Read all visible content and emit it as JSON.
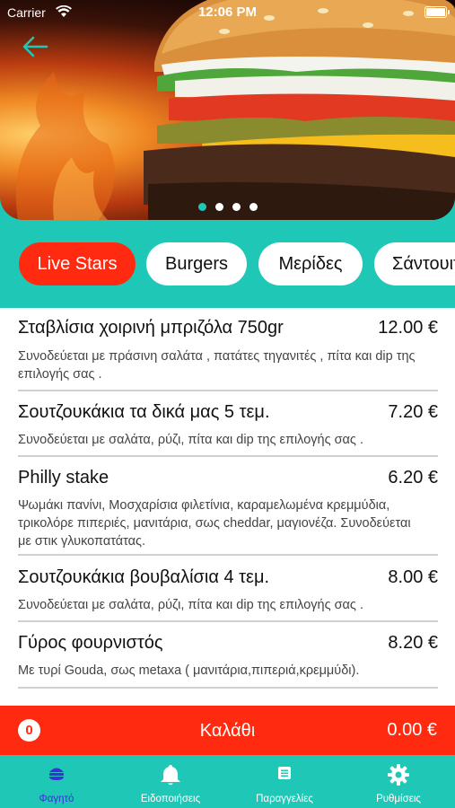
{
  "status_bar": {
    "carrier": "Carrier",
    "time": "12:06 PM"
  },
  "carousel": {
    "page_count": 4,
    "active_index": 0
  },
  "categories": [
    {
      "label": "Live Stars",
      "active": true
    },
    {
      "label": "Burgers",
      "active": false
    },
    {
      "label": "Μερίδες",
      "active": false
    },
    {
      "label": "Σάντουιτς",
      "active": false
    }
  ],
  "menu": {
    "items": [
      {
        "name": "Σταβλίσια χοιρινή μπριζόλα 750gr",
        "price": "12.00 €",
        "description": "Συνοδεύεται με πράσινη σαλάτα , πατάτες τηγανιτές , πίτα και dip της επιλογής σας ."
      },
      {
        "name": "Σουτζουκάκια τα δικά μας 5 τεμ.",
        "price": "7.20 €",
        "description": "Συνοδεύεται με σαλάτα, ρύζι, πίτα και dip της επιλογής σας ."
      },
      {
        "name": "Philly stake",
        "price": "6.20 €",
        "description": "Ψωμάκι πανίνι, Μοσχαρίσια φιλετίνια, καραμελωμένα κρεμμύδια, τρικολόρε πιπεριές, μανιτάρια, σως cheddar, μαγιονέζα. Συνοδεύεται με στικ γλυκοπατάτας."
      },
      {
        "name": "Σουτζουκάκια βουβαλίσια 4 τεμ.",
        "price": "8.00 €",
        "description": "Συνοδεύεται με σαλάτα, ρύζι, πίτα και dip της επιλογής σας ."
      },
      {
        "name": "Γύρος φουρνιστός",
        "price": "8.20 €",
        "description": "Με τυρί Gouda, σως metaxa ( μανιτάρια,πιπεριά,κρεμμύδι)."
      }
    ]
  },
  "cart": {
    "count": "0",
    "label": "Καλάθι",
    "total": "0.00 €"
  },
  "tabs": [
    {
      "label": "Φαγητό",
      "icon": "food-icon",
      "active": true
    },
    {
      "label": "Ειδοποιήσεις",
      "icon": "bell-icon",
      "active": false
    },
    {
      "label": "Παραγγελίες",
      "icon": "orders-icon",
      "active": false
    },
    {
      "label": "Ρυθμίσεις",
      "icon": "gear-icon",
      "active": false
    }
  ],
  "colors": {
    "accent": "#1fc7b6",
    "primary_red": "#ff2a10",
    "active_tab": "#3d2fd6"
  }
}
